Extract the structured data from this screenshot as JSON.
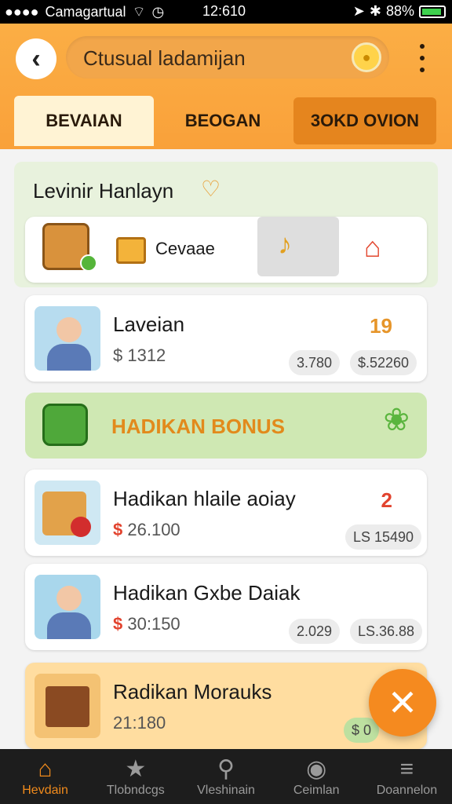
{
  "status": {
    "carrier": "Camagartual",
    "time": "12:610",
    "battery": "88%"
  },
  "header": {
    "back_icon": "back-arrow-icon",
    "search_text": "Ctusual ladamijan",
    "tabs": [
      "BEVAIAN",
      "BEOGAN",
      "3OKD OVION"
    ],
    "accent": "#f9a13a"
  },
  "section": {
    "title": "Levinir Hanlayn",
    "category_label": "Cevaae"
  },
  "cards": [
    {
      "name": "Laveian",
      "price": "$ 1312",
      "pill1": "3.780",
      "pill2": "$.52260",
      "rank": "19"
    },
    {
      "name": "Hadikan hlaile aoiay",
      "price_prefix": "$",
      "price": "26.100",
      "pill1": "LS 15490",
      "rank": "2"
    },
    {
      "name": "Hadikan Gxbe Daiak",
      "price_prefix": "$",
      "price": "30:150",
      "pill1": "2.029",
      "pill2": "LS.36.88"
    },
    {
      "name": "Radikan Morauks",
      "price": "21:180",
      "pill1": "$ 0"
    }
  ],
  "bonus": {
    "label": "HADIKAN BONUS"
  },
  "nav": [
    {
      "label": "Hevdain",
      "active": true
    },
    {
      "label": "Tlobndcgs"
    },
    {
      "label": "Vleshinain"
    },
    {
      "label": "Ceimlan"
    },
    {
      "label": "Doannelon"
    }
  ]
}
